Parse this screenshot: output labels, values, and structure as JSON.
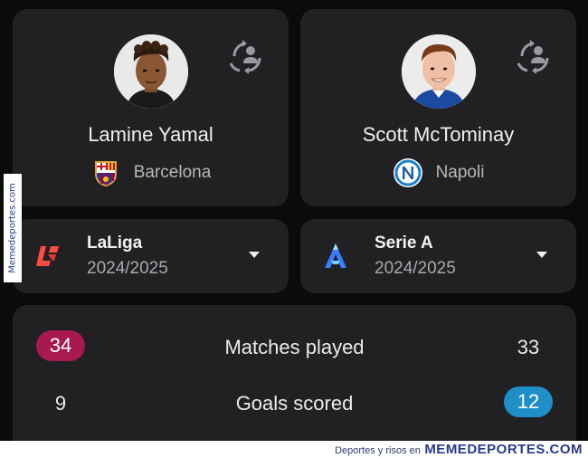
{
  "players": [
    {
      "name": "Lamine Yamal",
      "club": "Barcelona",
      "club_logo_icon": "barcelona-crest-icon",
      "avatar_icon": "player-photo-icon",
      "compare_icon": "switch-player-icon",
      "league": {
        "name": "LaLiga",
        "season": "2024/2025",
        "logo_icon": "laliga-logo-icon"
      }
    },
    {
      "name": "Scott McTominay",
      "club": "Napoli",
      "club_logo_icon": "napoli-crest-icon",
      "avatar_icon": "player-photo-icon",
      "compare_icon": "switch-player-icon",
      "league": {
        "name": "Serie A",
        "season": "2024/2025",
        "logo_icon": "serie-a-logo-icon"
      }
    }
  ],
  "stats": [
    {
      "label": "Matches played",
      "left": "34",
      "right": "33",
      "highlight": "left",
      "highlight_color": "#a8194f"
    },
    {
      "label": "Goals scored",
      "left": "9",
      "right": "12",
      "highlight": "right",
      "highlight_color": "#1f8fc7"
    }
  ],
  "watermark": {
    "side": "Memedeportes.com",
    "bottom_small": "Deportes y risos en",
    "bottom_big": "MEMEDEPORTES.COM"
  },
  "colors": {
    "background": "#0b0b0c",
    "card": "#212124",
    "barca_blue": "#1d3c8f",
    "barca_red": "#a50044",
    "napoli_blue": "#1b84c6",
    "laliga_red": "#ff4b44",
    "serie_a_blue": "#3a7bff"
  }
}
